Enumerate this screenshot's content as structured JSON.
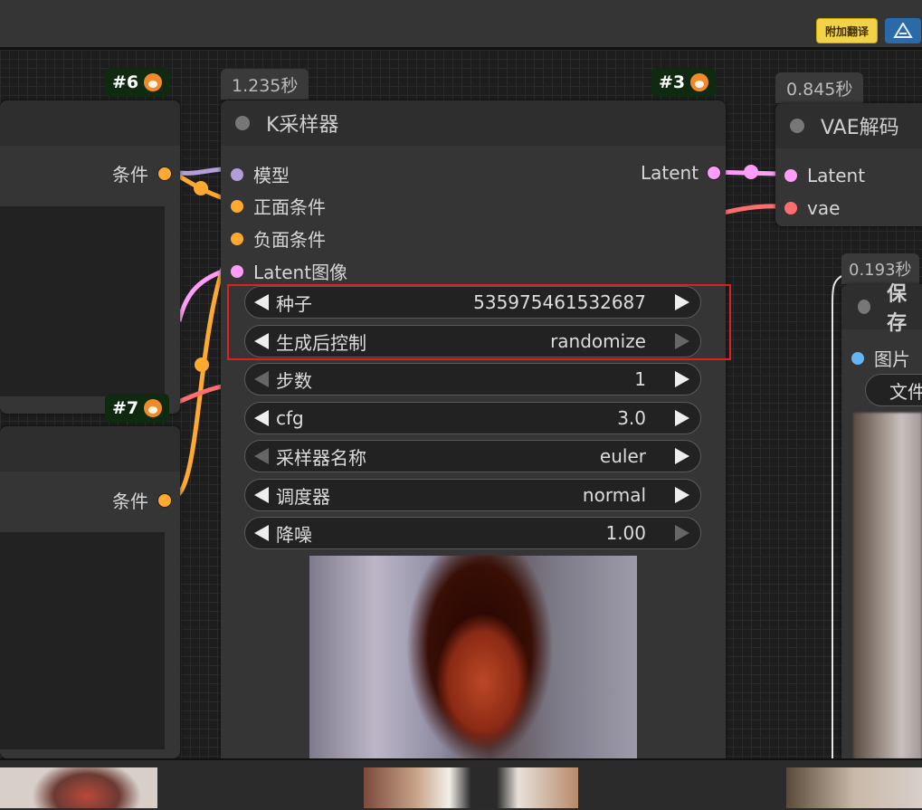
{
  "toolbar": {
    "translate_button": "附加翻译",
    "logo_icon": "comfy-logo-icon"
  },
  "nodes": {
    "clip_top": {
      "badge": "#6",
      "output_slot": "条件"
    },
    "clip_bottom": {
      "badge": "#7",
      "output_slot": "条件"
    },
    "ksampler": {
      "badge": "#3",
      "time": "1.235秒",
      "title": "K采样器",
      "inputs": [
        "模型",
        "正面条件",
        "负面条件",
        "Latent图像"
      ],
      "output": "Latent",
      "widgets": [
        {
          "label": "种子",
          "value": "535975461532687"
        },
        {
          "label": "生成后控制",
          "value": "randomize"
        },
        {
          "label": "步数",
          "value": "1"
        },
        {
          "label": "cfg",
          "value": "3.0"
        },
        {
          "label": "采样器名称",
          "value": "euler"
        },
        {
          "label": "调度器",
          "value": "normal"
        },
        {
          "label": "降噪",
          "value": "1.00"
        }
      ]
    },
    "vae_decode": {
      "time": "0.845秒",
      "title": "VAE解码",
      "inputs": [
        "Latent",
        "vae"
      ]
    },
    "save_image": {
      "time": "0.193秒",
      "title": "保存",
      "input": "图片",
      "widget_label": "文件"
    }
  },
  "colors": {
    "model": "#b39ddb",
    "conditioning": "#ffa931",
    "latent": "#ff9cf9",
    "vae": "#ff6e6e",
    "image": "#64b5f6",
    "highlight": "#e0201c"
  }
}
